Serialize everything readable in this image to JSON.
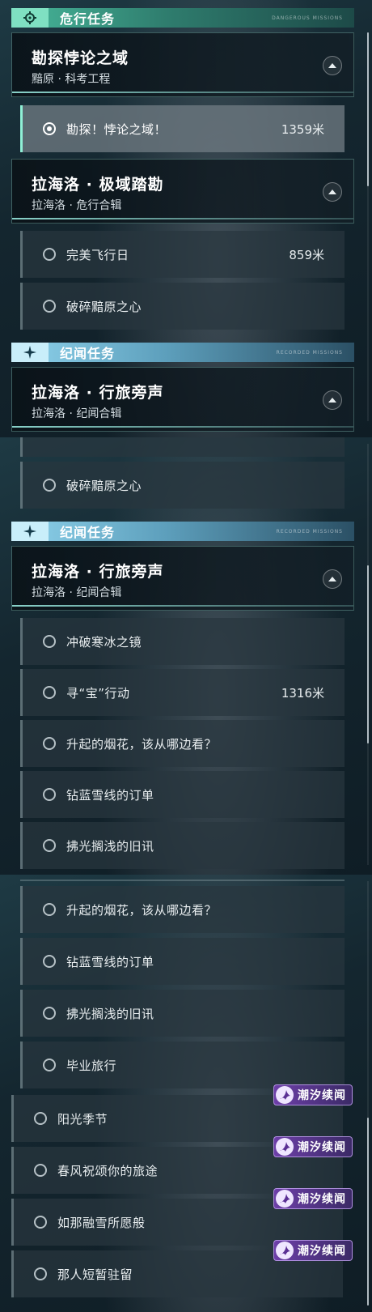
{
  "sections": {
    "danger": {
      "title": "危行任务",
      "deco": "DANGEROUS MISSIONS",
      "color": "#47b79a"
    },
    "lore": {
      "title": "纪闻任务",
      "deco": "RECORDED MISSIONS",
      "color": "#8fd3ec"
    }
  },
  "quests": {
    "q1": {
      "name": "勘探悖论之域",
      "sub": "黯原 · 科考工程"
    },
    "q2": {
      "name": "拉海洛 · 极域踏勘",
      "sub": "拉海洛 · 危行合辑"
    },
    "q3": {
      "name": "拉海洛 · 行旅旁声",
      "sub": "拉海洛 · 纪闻合辑"
    }
  },
  "items": {
    "i1": {
      "label": "勘探！悖论之域！",
      "distance": "1359米"
    },
    "i2": {
      "label": "完美飞行日",
      "distance": "859米"
    },
    "i3": {
      "label": "破碎黯原之心"
    },
    "i4": {
      "label": "冲破寒冰之镜"
    },
    "i5": {
      "label": "寻“宝”行动",
      "distance": "1316米"
    },
    "i6": {
      "label": "升起的烟花，该从哪边看？"
    },
    "i7": {
      "label": "钻蓝雪线的订单"
    },
    "i8": {
      "label": "拂光搁浅的旧讯"
    },
    "i9": {
      "label": "毕业旅行"
    },
    "i10": {
      "label": "阳光季节"
    },
    "i11": {
      "label": "春风祝颂你的旅途"
    },
    "i12": {
      "label": "如那融雪所愿般"
    },
    "i13": {
      "label": "那人短暂驻留"
    }
  },
  "tag": {
    "label": "潮汐续闻",
    "color": "#6d3fa8"
  },
  "icons": {
    "danger": "crosshair-icon",
    "lore": "sparkle-icon",
    "tag": "tide-icon",
    "toggle": "collapse-arrow-icon"
  }
}
